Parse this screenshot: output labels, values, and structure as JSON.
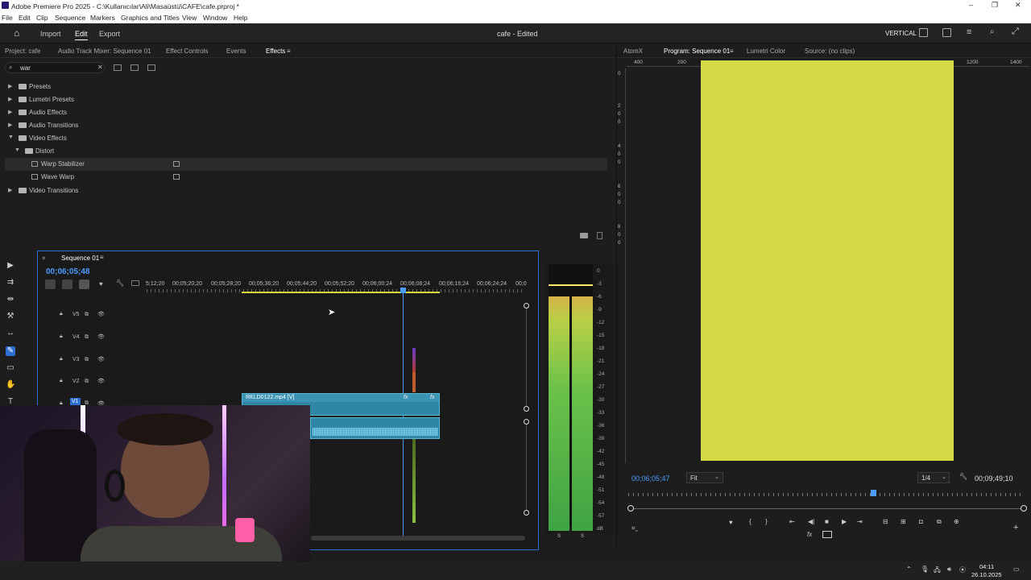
{
  "window": {
    "title": "Adobe Premiere Pro 2025 - C:\\Kullanıcılar\\Ali\\Masaüstü\\CAFE\\cafe.prproj *"
  },
  "menu": [
    "File",
    "Edit",
    "Clip",
    "Sequence",
    "Markers",
    "Graphics and Titles",
    "View",
    "Window",
    "Help"
  ],
  "appbar": {
    "import": "Import",
    "edit": "Edit",
    "export": "Export",
    "project_status": "cafe - Edited",
    "workspace": "VERTICAL"
  },
  "effects_panel": {
    "tabs": [
      "Project: cafe",
      "Audio Track Mixer: Sequence 01",
      "Effect Controls",
      "Events",
      "Effects"
    ],
    "search_value": "war",
    "tree": [
      "Presets",
      "Lumetri Presets",
      "Audio Effects",
      "Audio Transitions",
      "Video Effects",
      "Distort",
      "Warp Stabilizer",
      "Wave Warp",
      "Video Transitions"
    ]
  },
  "timeline": {
    "tab": "Sequence 01",
    "timecode": "00;06;05;48",
    "ruler": [
      "5;12;20",
      "00;05;20;20",
      "00;05;28;20",
      "00;05;36;20",
      "00;05;44;20",
      "00;05;52;20",
      "00;06;00;24",
      "00;06;08;24",
      "00;06;16;24",
      "00;06;24;24",
      "00;0"
    ],
    "tracks": [
      "V5",
      "V4",
      "V3",
      "V2",
      "V1"
    ],
    "clip_label": "RKLD0122.mp4 [V]",
    "fx": "fx"
  },
  "meter": {
    "db": [
      "0",
      "-3",
      "-6",
      "-9",
      "-12",
      "-15",
      "-18",
      "-21",
      "-24",
      "-27",
      "-30",
      "-33",
      "-36",
      "-39",
      "-42",
      "-45",
      "-48",
      "-51",
      "-54",
      "-57",
      "dB"
    ],
    "s1": "S",
    "s2": "S"
  },
  "program": {
    "tabs": [
      "AtomX",
      "Program: Sequence 01",
      "Lumetri Color",
      "Source: (no clips)"
    ],
    "ruler": [
      "400",
      "200",
      "1200",
      "1400"
    ],
    "vruler": [
      "0",
      "2",
      "0",
      "0",
      "4",
      "0",
      "0",
      "6",
      "0",
      "0",
      "8",
      "0",
      "0"
    ],
    "timecode": "00;06;05;47",
    "fit": "Fit",
    "quality": "1/4",
    "duration": "00;09;49;10",
    "frame_color": "#d4db46"
  },
  "taskbar": {
    "time": "04:11",
    "date": "26.10.2025"
  }
}
